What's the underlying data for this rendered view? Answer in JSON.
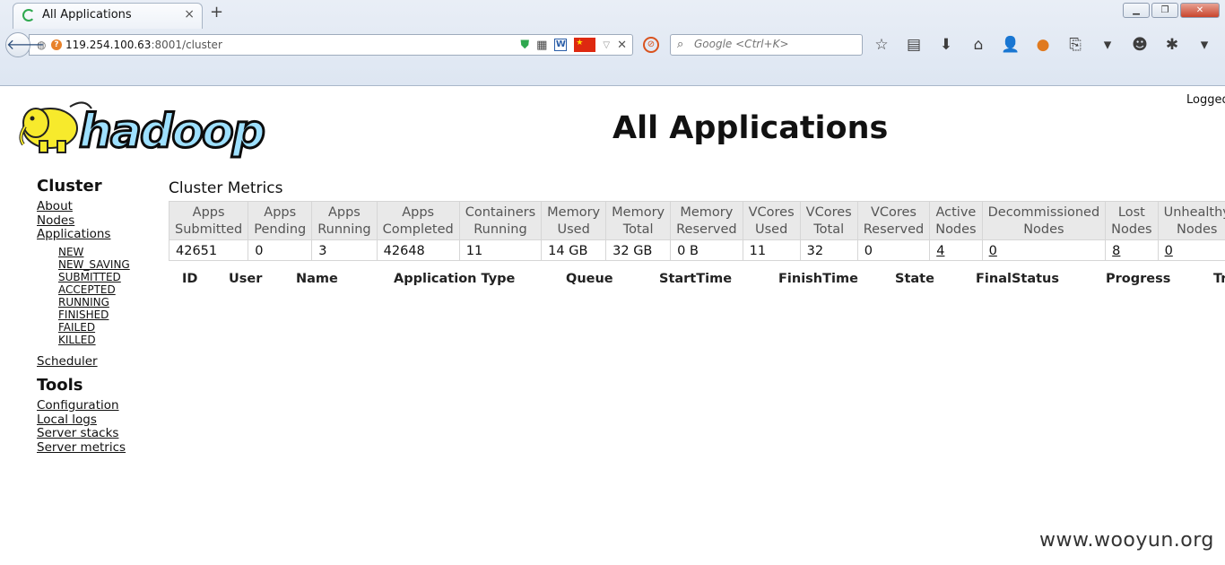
{
  "browser": {
    "tab_title": "All Applications",
    "url_host": "119.254.100.63",
    "url_rest": ":8001/cluster",
    "search_placeholder": "Google <Ctrl+K>",
    "new_tab": "+",
    "tab_close": "×"
  },
  "header": {
    "logo_text": "hadoop",
    "page_title": "All Applications",
    "logged_in": "Logged"
  },
  "nav": {
    "cluster_heading": "Cluster",
    "cluster_links": [
      "About",
      "Nodes",
      "Applications"
    ],
    "app_states": [
      "NEW",
      "NEW_SAVING",
      "SUBMITTED",
      "ACCEPTED",
      "RUNNING",
      "FINISHED",
      "FAILED",
      "KILLED"
    ],
    "scheduler": "Scheduler",
    "tools_heading": "Tools",
    "tools_links": [
      "Configuration",
      "Local logs",
      "Server stacks",
      "Server metrics"
    ]
  },
  "metrics": {
    "title": "Cluster Metrics",
    "headers": [
      [
        "Apps",
        "Submitted"
      ],
      [
        "Apps",
        "Pending"
      ],
      [
        "Apps",
        "Running"
      ],
      [
        "Apps",
        "Completed"
      ],
      [
        "Containers",
        "Running"
      ],
      [
        "Memory",
        "Used"
      ],
      [
        "Memory",
        "Total"
      ],
      [
        "Memory",
        "Reserved"
      ],
      [
        "VCores",
        "Used"
      ],
      [
        "VCores",
        "Total"
      ],
      [
        "VCores",
        "Reserved"
      ],
      [
        "Active",
        "Nodes"
      ],
      [
        "Decommissioned",
        "Nodes"
      ],
      [
        "Lost",
        "Nodes"
      ],
      [
        "Unhealthy",
        "Nodes"
      ]
    ],
    "values": [
      "42651",
      "0",
      "3",
      "42648",
      "11",
      "14 GB",
      "32 GB",
      "0 B",
      "11",
      "32",
      "0",
      "4",
      "0",
      "8",
      "0"
    ],
    "linked": [
      false,
      false,
      false,
      false,
      false,
      false,
      false,
      false,
      false,
      false,
      false,
      true,
      true,
      true,
      true
    ]
  },
  "apps_table": {
    "columns": [
      "ID",
      "User",
      "Name",
      "Application Type",
      "Queue",
      "StartTime",
      "FinishTime",
      "State",
      "FinalStatus",
      "Progress",
      "Tr"
    ]
  },
  "watermark": "www.wooyun.org"
}
